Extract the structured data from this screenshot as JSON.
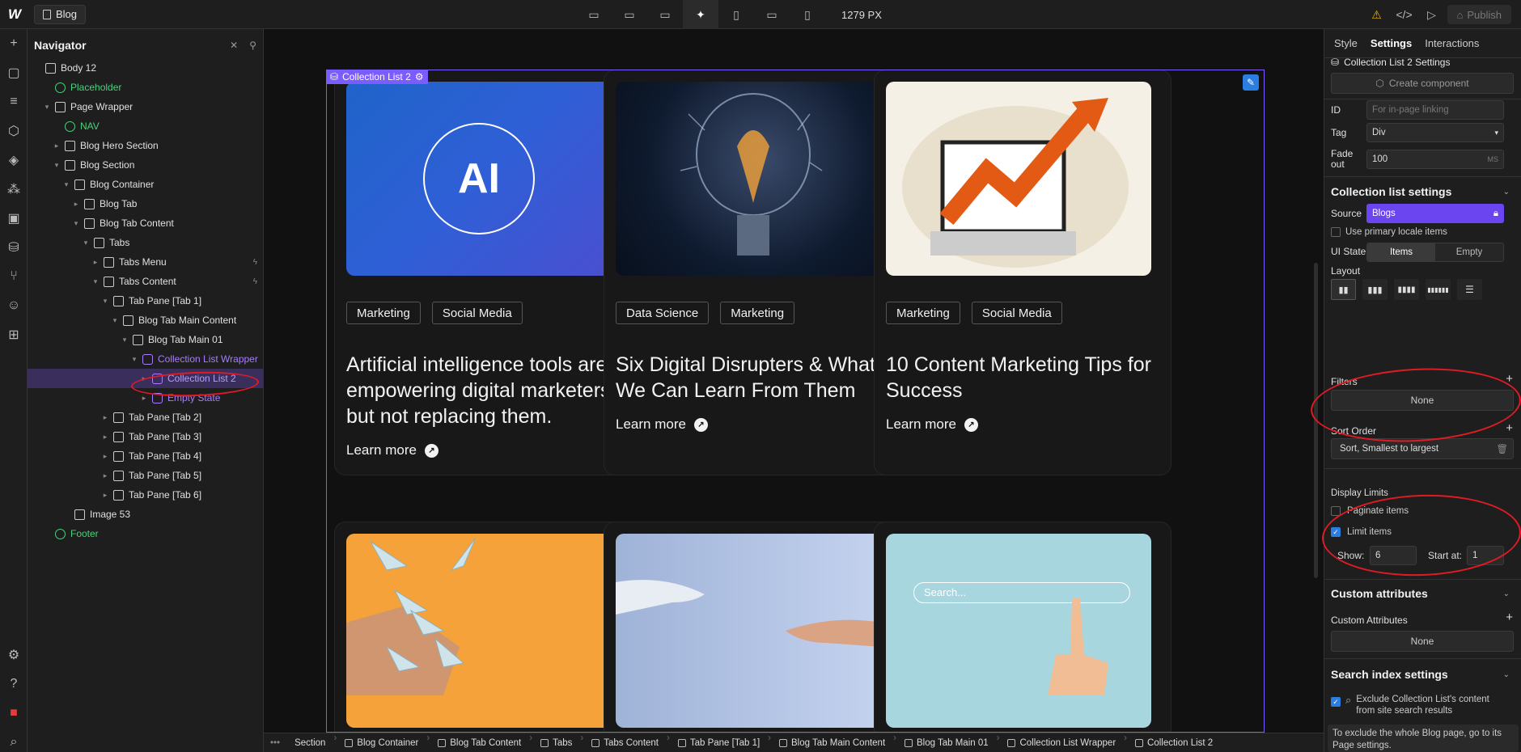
{
  "topbar": {
    "page_name": "Blog",
    "width_readout": "1279 PX",
    "publish_label": "Publish"
  },
  "navigator": {
    "title": "Navigator",
    "tree": [
      {
        "label": "Body 12",
        "depth": 0,
        "caret": "",
        "style": ""
      },
      {
        "label": "Placeholder",
        "depth": 1,
        "caret": "",
        "style": "green"
      },
      {
        "label": "Page Wrapper",
        "depth": 1,
        "caret": "▾",
        "style": ""
      },
      {
        "label": "NAV",
        "depth": 2,
        "caret": "",
        "style": "green"
      },
      {
        "label": "Blog Hero Section",
        "depth": 2,
        "caret": "▸",
        "style": ""
      },
      {
        "label": "Blog Section",
        "depth": 2,
        "caret": "▾",
        "style": ""
      },
      {
        "label": "Blog Container",
        "depth": 3,
        "caret": "▾",
        "style": ""
      },
      {
        "label": "Blog Tab",
        "depth": 4,
        "caret": "▸",
        "style": ""
      },
      {
        "label": "Blog Tab Content",
        "depth": 4,
        "caret": "▾",
        "style": ""
      },
      {
        "label": "Tabs",
        "depth": 5,
        "caret": "▾",
        "style": ""
      },
      {
        "label": "Tabs Menu",
        "depth": 6,
        "caret": "▸",
        "style": "",
        "bolt": true
      },
      {
        "label": "Tabs Content",
        "depth": 6,
        "caret": "▾",
        "style": "",
        "bolt": true
      },
      {
        "label": "Tab Pane [Tab 1]",
        "depth": 7,
        "caret": "▾",
        "style": ""
      },
      {
        "label": "Blog Tab Main Content",
        "depth": 8,
        "caret": "▾",
        "style": ""
      },
      {
        "label": "Blog Tab Main 01",
        "depth": 9,
        "caret": "▾",
        "style": ""
      },
      {
        "label": "Collection List Wrapper",
        "depth": 10,
        "caret": "▾",
        "style": "purple"
      },
      {
        "label": "Collection List 2",
        "depth": 11,
        "caret": "▸",
        "style": "sel"
      },
      {
        "label": "Empty State",
        "depth": 11,
        "caret": "▸",
        "style": "purple"
      },
      {
        "label": "Tab Pane [Tab 2]",
        "depth": 7,
        "caret": "▸",
        "style": ""
      },
      {
        "label": "Tab Pane [Tab 3]",
        "depth": 7,
        "caret": "▸",
        "style": ""
      },
      {
        "label": "Tab Pane [Tab 4]",
        "depth": 7,
        "caret": "▸",
        "style": ""
      },
      {
        "label": "Tab Pane [Tab 5]",
        "depth": 7,
        "caret": "▸",
        "style": ""
      },
      {
        "label": "Tab Pane [Tab 6]",
        "depth": 7,
        "caret": "▸",
        "style": ""
      },
      {
        "label": "Image 53",
        "depth": 3,
        "caret": "",
        "style": ""
      },
      {
        "label": "Footer",
        "depth": 1,
        "caret": "",
        "style": "green"
      }
    ]
  },
  "canvas": {
    "collection_tag": "Collection List 2",
    "learn_more": "Learn more",
    "cards": [
      {
        "tags": [
          "Marketing",
          "Social Media"
        ],
        "title": "Artificial intelligence tools are empowering digital marketers but not replacing them.",
        "image": "ai",
        "image_text": "AI"
      },
      {
        "tags": [
          "Data Science",
          "Marketing"
        ],
        "title": "Six Digital Disrupters & What We Can Learn From Them",
        "image": "bulb"
      },
      {
        "tags": [
          "Marketing",
          "Social Media"
        ],
        "title": "10 Content Marketing Tips for Success",
        "image": "chart"
      },
      {
        "image": "planes"
      },
      {
        "image": "hands"
      },
      {
        "image": "search",
        "image_text": "Search..."
      }
    ]
  },
  "breadcrumbs": [
    "Section",
    "Blog Container",
    "Blog Tab Content",
    "Tabs",
    "Tabs Content",
    "Tab Pane [Tab 1]",
    "Blog Tab Main Content",
    "Blog Tab Main 01",
    "Collection List Wrapper",
    "Collection List 2"
  ],
  "right_panel": {
    "tabs": [
      "Style",
      "Settings",
      "Interactions"
    ],
    "settings_title": "Collection List 2 Settings",
    "create_component": "Create component",
    "id_label": "ID",
    "id_placeholder": "For in-page linking",
    "tag_label": "Tag",
    "tag_value": "Div",
    "fade_label": "Fade out",
    "fade_value": "100",
    "fade_unit": "MS",
    "cl_settings_head": "Collection list settings",
    "source_label": "Source",
    "source_value": "Blogs",
    "primary_locale": "Use primary locale items",
    "ui_state_label": "UI State",
    "ui_state_items": "Items",
    "ui_state_empty": "Empty",
    "layout_label": "Layout",
    "filters_label": "Filters",
    "filters_value": "None",
    "sort_label": "Sort Order",
    "sort_value": "Sort, Smallest to largest",
    "display_limits": "Display Limits",
    "paginate": "Paginate items",
    "limit": "Limit items",
    "show_label": "Show:",
    "show_value": "6",
    "start_label": "Start at:",
    "start_value": "1",
    "custom_attr_head": "Custom attributes",
    "custom_attr_label": "Custom Attributes",
    "custom_attr_value": "None",
    "search_head": "Search index settings",
    "exclude_text": "Exclude Collection List's content from site search results",
    "note_text": "To exclude the whole Blog page, go to its Page settings."
  },
  "colors": {
    "accent": "#7a5cff",
    "annotation": "#e01b24",
    "selected": "#3a2f5c"
  }
}
